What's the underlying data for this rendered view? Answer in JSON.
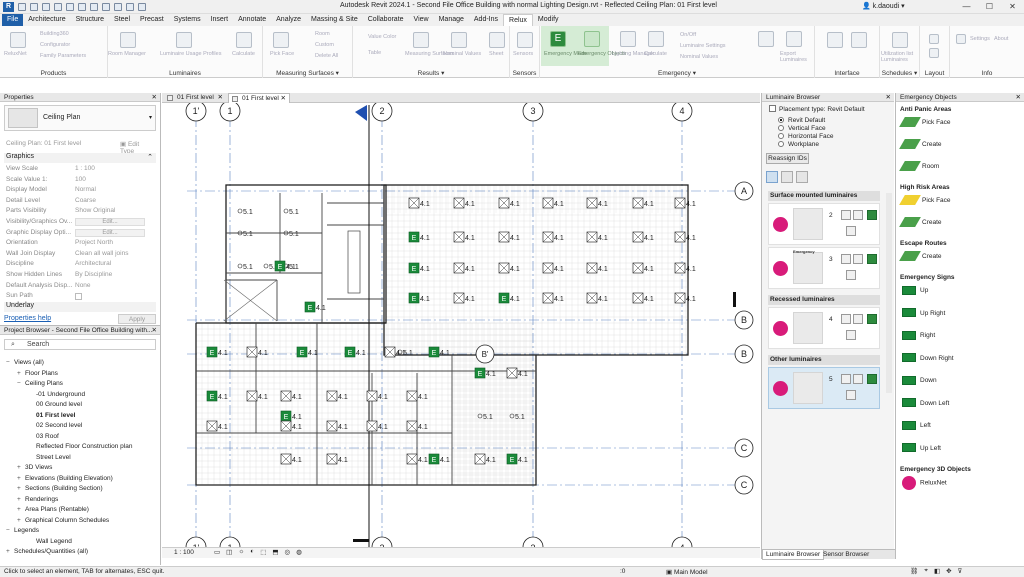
{
  "title_bar": {
    "app_badge": "R",
    "window_title": "Autodesk Revit 2024.1 - Second File Office Building with normal Lighting Design.rvt - Reflected Ceiling Plan: 01 First level",
    "user": "k.daoudi",
    "minimize": "—",
    "maximize": "☐",
    "close": "✕"
  },
  "ribbon_tabs": [
    "File",
    "Architecture",
    "Structure",
    "Steel",
    "Precast",
    "Systems",
    "Insert",
    "Annotate",
    "Analyze",
    "Massing & Site",
    "Collaborate",
    "View",
    "Manage",
    "Add-Ins",
    "Relux",
    "Modify"
  ],
  "ribbon_active_tab": "Relux",
  "ribbon_groups": {
    "products": "Products",
    "luminaires": "Luminaires",
    "measuring_surfaces": "Measuring Surfaces ▾",
    "results": "Results ▾",
    "sensors": "Sensors",
    "emergency": "Emergency ▾",
    "interface": "Interface",
    "schedules": "Schedules ▾",
    "layout": "Layout",
    "info": "Info"
  },
  "ribbon_labels": {
    "building360": "Building360",
    "configurator": "Configurator",
    "family_parameters": "Family Parameters",
    "reluxnet": "ReluxNet",
    "room_manager": "Room Manager",
    "luminaire_usage_profiles": "Luminaire Usage Profiles",
    "calculate": "Calculate",
    "pick_face": "Pick Face",
    "room": "Room",
    "custom": "Custom",
    "delete_all": "Delete All",
    "value_color": "Value Color",
    "table": "Table",
    "measuring_surfaces_btn": "Measuring Surfaces",
    "nominal_values": "Nominal Values",
    "sheet": "Sheet",
    "sensors_btn": "Sensors",
    "emergency_mode": "Emergency Mode",
    "emergency_objects": "Emergency Objects",
    "lighting_manager": "Lighting Manager",
    "calculate2": "Calculate",
    "on_off": "On/Off",
    "luminaire_settings": "Luminaire Settings",
    "nominal_values2": "Nominal Values",
    "export_luminaires": "Export Luminaires",
    "utilization_list": "Utilization list Luminaires",
    "settings": "Settings",
    "about": "About"
  },
  "properties": {
    "header": "Properties",
    "type_name": "Ceiling Plan",
    "instance_selector": "Ceiling Plan: 01 First level",
    "edit_type": "Edit Type",
    "graphics_section": "Graphics",
    "rows": [
      {
        "label": "View Scale",
        "value": "1 : 100"
      },
      {
        "label": "Scale Value   1:",
        "value": "100"
      },
      {
        "label": "Display Model",
        "value": "Normal"
      },
      {
        "label": "Detail Level",
        "value": "Coarse"
      },
      {
        "label": "Parts Visibility",
        "value": "Show Original"
      },
      {
        "label": "Visibility/Graphics Ov...",
        "value": "Edit..."
      },
      {
        "label": "Graphic Display Opti...",
        "value": "Edit..."
      },
      {
        "label": "Orientation",
        "value": "Project North"
      },
      {
        "label": "Wall Join Display",
        "value": "Clean all wall joins"
      },
      {
        "label": "Discipline",
        "value": "Architectural"
      },
      {
        "label": "Show Hidden Lines",
        "value": "By Discipline"
      },
      {
        "label": "Default Analysis Disp...",
        "value": "None"
      },
      {
        "label": "Sun Path",
        "value": ""
      }
    ],
    "underlay_section": "Underlay",
    "help_link": "Properties help",
    "apply": "Apply"
  },
  "project_browser": {
    "header": "Project Browser - Second File Office Building with...",
    "search_placeholder": "Search",
    "items": [
      {
        "label": "Views (all)",
        "indent": 0,
        "toggle": "−"
      },
      {
        "label": "Floor Plans",
        "indent": 1,
        "toggle": "+"
      },
      {
        "label": "Ceiling Plans",
        "indent": 1,
        "toggle": "−"
      },
      {
        "label": "-01 Underground",
        "indent": 2,
        "toggle": ""
      },
      {
        "label": "00 Ground level",
        "indent": 2,
        "toggle": ""
      },
      {
        "label": "01 First level",
        "indent": 2,
        "toggle": "",
        "bold": true
      },
      {
        "label": "02 Second level",
        "indent": 2,
        "toggle": ""
      },
      {
        "label": "03 Roof",
        "indent": 2,
        "toggle": ""
      },
      {
        "label": "Reflected Floor Construction plan",
        "indent": 2,
        "toggle": ""
      },
      {
        "label": "Street Level",
        "indent": 2,
        "toggle": ""
      },
      {
        "label": "3D Views",
        "indent": 1,
        "toggle": "+"
      },
      {
        "label": "Elevations (Building Elevation)",
        "indent": 1,
        "toggle": "+"
      },
      {
        "label": "Sections (Building Section)",
        "indent": 1,
        "toggle": "+"
      },
      {
        "label": "Renderings",
        "indent": 1,
        "toggle": "+"
      },
      {
        "label": "Area Plans (Rentable)",
        "indent": 1,
        "toggle": "+"
      },
      {
        "label": "Graphical Column Schedules",
        "indent": 1,
        "toggle": "+"
      },
      {
        "label": "Legends",
        "indent": 0,
        "toggle": "−"
      },
      {
        "label": "Wall Legend",
        "indent": 2,
        "toggle": ""
      },
      {
        "label": "Schedules/Quantities (all)",
        "indent": 0,
        "toggle": "+"
      }
    ]
  },
  "view_tabs": [
    {
      "label": "01 First level",
      "active": false
    },
    {
      "label": "01 First level",
      "active": true
    }
  ],
  "canvas": {
    "grid_top": [
      "1'",
      "1",
      "2",
      "3",
      "4"
    ],
    "grid_right": [
      "A",
      "B",
      "B",
      "C",
      "C"
    ],
    "grid_internal": "B'",
    "luminaire_tag": "4.1",
    "luminaire_tag_alt": "5.1",
    "emergency_glyph": "E"
  },
  "view_bar": {
    "scale": "1 : 100"
  },
  "luminaire_browser": {
    "header": "Luminaire Browser",
    "placement_label": "Placement type: Revit Default",
    "placement_options": [
      "Revit Default",
      "Vertical Face",
      "Horizontal Face",
      "Workplane"
    ],
    "placement_selected": 0,
    "reassign": "Reassign IDs",
    "categories": [
      {
        "label": "Surface mounted luminaires",
        "cards": [
          "2",
          "3"
        ]
      },
      {
        "label": "Recessed luminaires",
        "cards": [
          "4"
        ]
      },
      {
        "label": "Other luminaires",
        "cards": [
          "5"
        ]
      }
    ],
    "card_caption_3": "Emergency",
    "tabs": [
      "Luminaire Browser",
      "Sensor Browser"
    ]
  },
  "emergency_objects": {
    "header": "Emergency Objects",
    "groups": [
      {
        "title": "Anti Panic Areas",
        "items": [
          "Pick Face",
          "Create",
          "Room"
        ]
      },
      {
        "title": "High Risk Areas",
        "items": [
          "Pick Face",
          "Create"
        ]
      },
      {
        "title": "Escape Routes",
        "items": [
          "Create"
        ]
      },
      {
        "title": "Emergency Signs",
        "items": [
          "Up",
          "Up Right",
          "Right",
          "Down Right",
          "Down",
          "Down Left",
          "Left",
          "Up Left"
        ]
      },
      {
        "title": "Emergency 3D Objects",
        "items": [
          "ReluxNet"
        ]
      }
    ]
  },
  "status_bar": {
    "message": "Click to select an element, TAB for alternates, ESC quit.",
    "zero": ":0",
    "model": "Main Model"
  },
  "colors": {
    "revit_blue": "#1f5fa8",
    "relux_pink": "#d81b7a",
    "emergency_green": "#1a8a3a",
    "grid_blue": "#5b82c2"
  }
}
